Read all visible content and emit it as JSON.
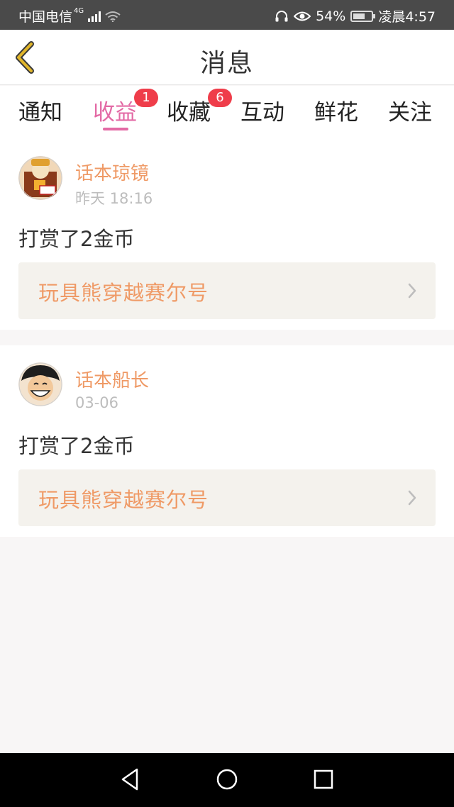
{
  "status_bar": {
    "carrier": "中国电信",
    "network": "4G",
    "battery": "54%",
    "time": "凌晨4:57"
  },
  "header": {
    "title": "消息"
  },
  "tabs": [
    {
      "label": "通知",
      "active": false
    },
    {
      "label": "收益",
      "active": true,
      "badge": "1"
    },
    {
      "label": "收藏",
      "active": false,
      "badge": "6"
    },
    {
      "label": "互动",
      "active": false
    },
    {
      "label": "鲜花",
      "active": false
    },
    {
      "label": "关注",
      "active": false
    }
  ],
  "messages": [
    {
      "username": "话本琼镜",
      "time": "昨天 18:16",
      "text": "打赏了2金币",
      "link": "玩具熊穿越赛尔号"
    },
    {
      "username": "话本船长",
      "time": "03-06",
      "text": "打赏了2金币",
      "link": "玩具熊穿越赛尔号"
    }
  ],
  "colors": {
    "accent": "#e36aa5",
    "username": "#ef9a66",
    "badge": "#ef3d4a",
    "back_arrow": "#e0b52a"
  }
}
